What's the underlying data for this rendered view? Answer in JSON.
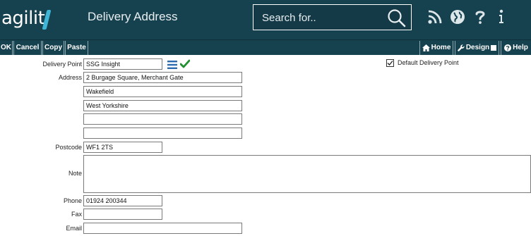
{
  "header": {
    "logo_text": "agilit",
    "title": "Delivery Address",
    "search": {
      "placeholder": "Search for.."
    },
    "icons": [
      "rss-icon",
      "globe-icon",
      "help-icon",
      "info-icon"
    ]
  },
  "toolbar": {
    "ok_label": "OK",
    "cancel_label": "Cancel",
    "copy_label": "Copy",
    "paste_label": "Paste",
    "home_label": "Home",
    "design_label": "Design",
    "help_label": "Help"
  },
  "form": {
    "delivery_point": {
      "label": "Delivery Point",
      "value": "SSG Insight"
    },
    "address": {
      "label": "Address",
      "line1": "2 Burgage Square, Merchant Gate",
      "line2": "Wakefield",
      "line3": "West Yorkshire",
      "line4": "",
      "line5": ""
    },
    "postcode": {
      "label": "Postcode",
      "value": "WF1 2TS"
    },
    "note": {
      "label": "Note",
      "value": ""
    },
    "phone": {
      "label": "Phone",
      "value": "01924 200344"
    },
    "fax": {
      "label": "Fax",
      "value": ""
    },
    "email": {
      "label": "Email",
      "value": ""
    },
    "default_delivery_point": {
      "label": "Default Delivery Point",
      "checked": true
    }
  },
  "colors": {
    "header_bg": "#16414f",
    "accent": "#3fb6d6",
    "list_icon": "#2b6cb0",
    "check_icon": "#1f8f2f"
  }
}
